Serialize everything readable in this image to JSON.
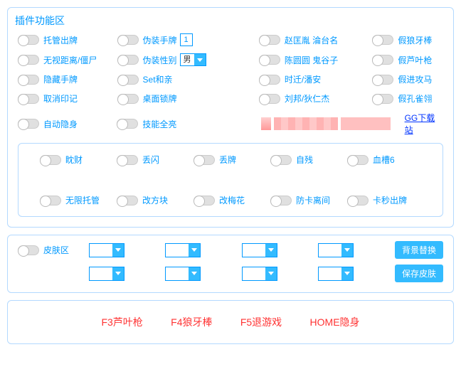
{
  "pluginArea": {
    "title": "插件功能区",
    "rows": [
      {
        "c1": "托管出牌",
        "c2": "伪装手牌",
        "c2box": "1",
        "c3": "赵匡胤 淪台名",
        "c4": "假狼牙棒"
      },
      {
        "c1": "无视距离/僵尸",
        "c2": "伪装性别",
        "c2sel": "男",
        "c3": "陈圆圆 鬼谷子",
        "c4": "假芦叶枪"
      },
      {
        "c1": "隐藏手牌",
        "c2": "Set和亲",
        "c3": "时迁/潘安",
        "c4": "假进攻马"
      },
      {
        "c1": "取消印记",
        "c2": "桌面锁牌",
        "c3": "刘邦/狄仁杰",
        "c4": "假孔雀翎"
      },
      {
        "c1": "自动隐身",
        "c2": "技能全亮",
        "blur": true,
        "link": "GG下载站"
      }
    ],
    "inner": {
      "row1": [
        "眈财",
        "丢闪",
        "丢牌",
        "自残",
        "血槽6"
      ],
      "row2": [
        "无限托管",
        "改方块",
        "改梅花",
        "防卡离间",
        "卡秒出牌"
      ]
    }
  },
  "skinArea": {
    "label": "皮肤区",
    "btn1": "背景替换",
    "btn2": "保存皮肤"
  },
  "hotkeys": [
    "F3芦叶枪",
    "F4狼牙棒",
    "F5退游戏",
    "HOME隐身"
  ]
}
